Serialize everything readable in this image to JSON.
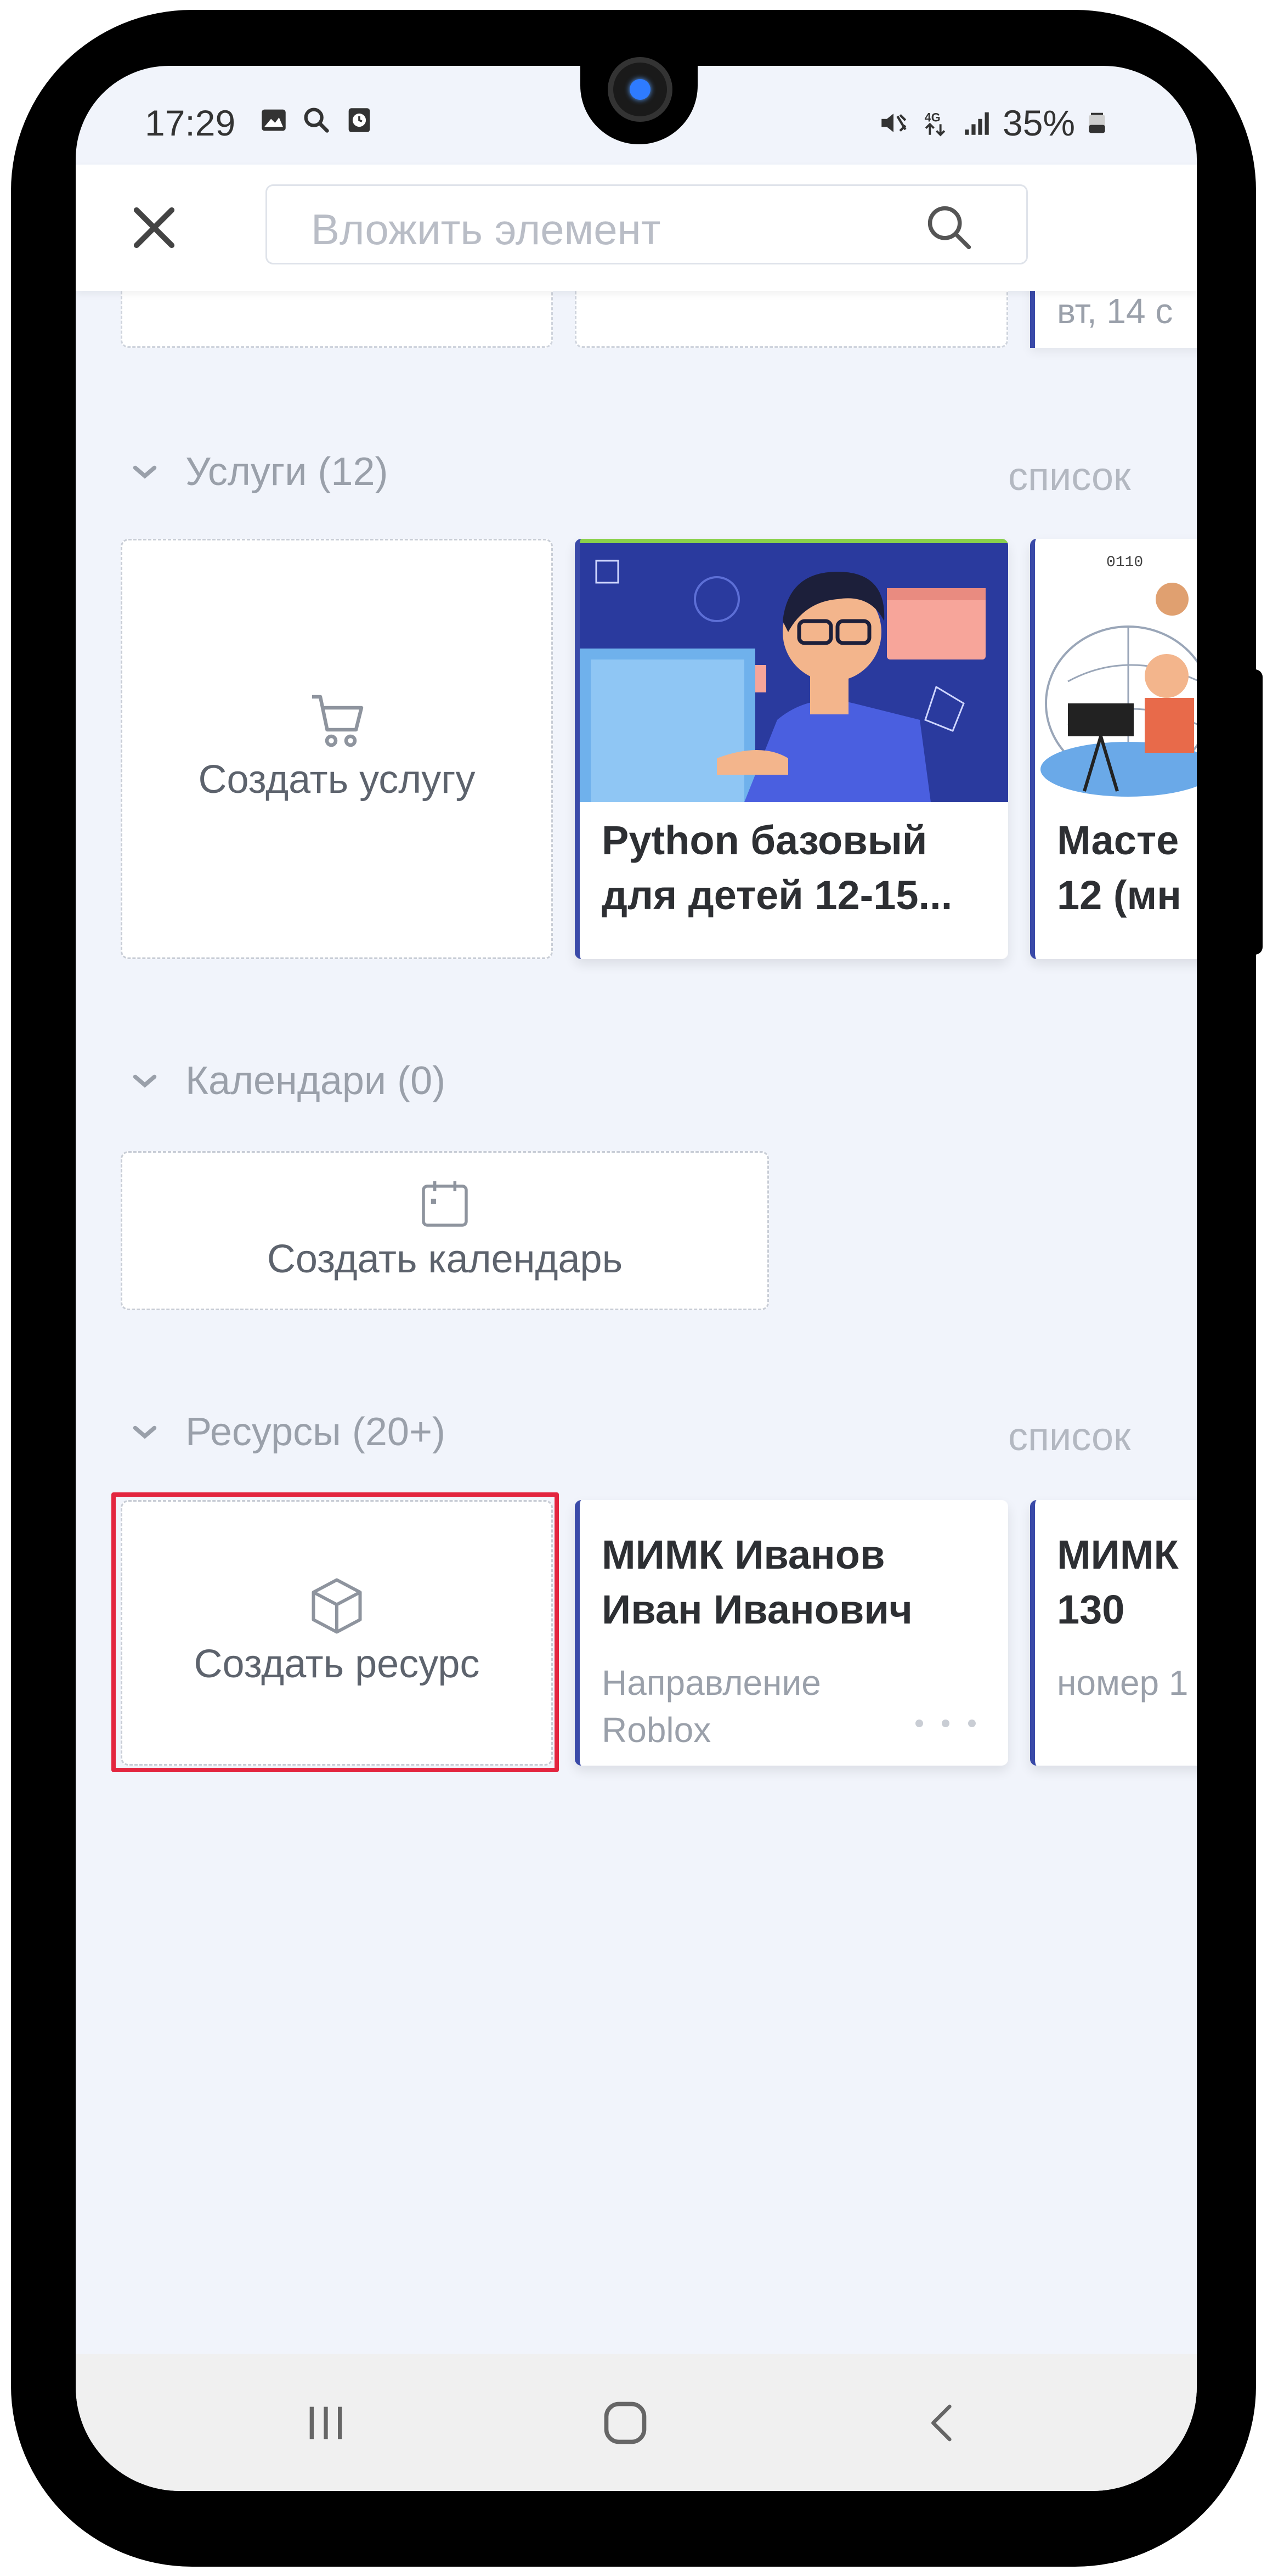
{
  "status_bar": {
    "time": "17:29",
    "battery": "35%",
    "network": "4G"
  },
  "header": {
    "search_placeholder": "Вложить элемент"
  },
  "top_partial": {
    "date_text": "вт, 14 с"
  },
  "services": {
    "title": "Услуги (12)",
    "view_link": "список",
    "create_label": "Создать услугу",
    "cards": [
      {
        "title_line1": "Python базовый",
        "title_line2": "для детей 12-15..."
      },
      {
        "title_line1": "Масте",
        "title_line2": "12 (мн"
      }
    ]
  },
  "calendars": {
    "title": "Календари (0)",
    "create_label": "Создать календарь"
  },
  "resources": {
    "title": "Ресурсы (20+)",
    "view_link": "список",
    "create_label": "Создать ресурс",
    "cards": [
      {
        "title_line1": "МИМК Иванов",
        "title_line2": "Иван Иванович",
        "sub_line1": "Направление",
        "sub_line2": "Roblox"
      },
      {
        "title_line1": "МИМК",
        "title_line2": "130",
        "sub_line1": "номер 1"
      }
    ]
  },
  "colors": {
    "accent_border": "#3a4aa8",
    "highlight": "#e3253f",
    "screen_bg": "#f1f4fb"
  }
}
